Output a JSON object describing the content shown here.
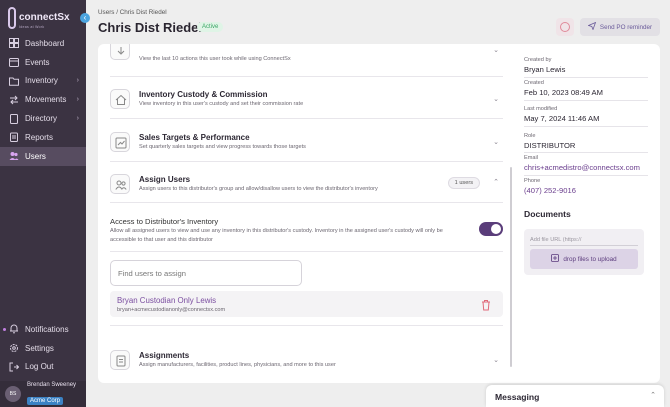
{
  "app": {
    "logo_text": "connectSx",
    "logo_subtext": "Ideas at Work",
    "collapse_icon": "chevron-left-icon"
  },
  "sidebar": {
    "items": [
      {
        "label": "Dashboard",
        "icon": "dashboard-icon",
        "has_submenu": false,
        "active": false
      },
      {
        "label": "Events",
        "icon": "calendar-icon",
        "has_submenu": false,
        "active": false
      },
      {
        "label": "Inventory",
        "icon": "folder-icon",
        "has_submenu": true,
        "active": false
      },
      {
        "label": "Movements",
        "icon": "arrows-icon",
        "has_submenu": true,
        "active": false
      },
      {
        "label": "Directory",
        "icon": "book-icon",
        "has_submenu": true,
        "active": false
      },
      {
        "label": "Reports",
        "icon": "clipboard-icon",
        "has_submenu": false,
        "active": false
      },
      {
        "label": "Users",
        "icon": "users-icon",
        "has_submenu": false,
        "active": true
      }
    ],
    "bottom_items": [
      {
        "label": "Notifications",
        "icon": "bell-icon"
      },
      {
        "label": "Settings",
        "icon": "gear-icon"
      },
      {
        "label": "Log Out",
        "icon": "logout-icon"
      }
    ],
    "user": {
      "initials": "BS",
      "name": "Brendan Sweeney",
      "org": "Acme Corp"
    }
  },
  "header": {
    "breadcrumb": [
      "Users",
      "/",
      "Chris Dist Riedel"
    ],
    "title": "Chris Dist Riedel",
    "status": "Active",
    "send_button_label": "Send PO reminder"
  },
  "sections": [
    {
      "title": "",
      "description": "View the last 10 actions this user took while using ConnectSx",
      "icon": "activity-icon"
    },
    {
      "title": "Inventory Custody & Commission",
      "description": "View inventory in this user's custody and set their commission rate",
      "icon": "house-icon"
    },
    {
      "title": "Sales Targets & Performance",
      "description": "Set quarterly sales targets and view progress towards those targets",
      "icon": "chart-icon"
    },
    {
      "title": "Assign Users",
      "description": "Assign users to this distributor's group and allow/disallow users to view the distributor's inventory",
      "icon": "users-group-icon",
      "count": "1 users",
      "expanded": true
    },
    {
      "title": "Assignments",
      "description": "Assign manufacturers, facilities, product lines, physicians, and more to this user",
      "icon": "clipboard-list-icon"
    }
  ],
  "access": {
    "title": "Access to Distributor's Inventory",
    "description": "Allow all assigned users to view and use any inventory in this distributor's custody. Inventory in the assigned user's custody will only be accessible to that user and this distributor",
    "enabled": true
  },
  "assign_search": {
    "placeholder": "Find users to assign"
  },
  "assigned_users": [
    {
      "name": "Bryan Custodian Only Lewis",
      "email": "bryan+acmecustodianonly@connectsx.com"
    }
  ],
  "meta": {
    "created_by_label": "Created by",
    "created_by": "Bryan Lewis",
    "created_label": "Created",
    "created": "Feb 10, 2023 08:49 AM",
    "modified_label": "Last modified",
    "modified": "May 7, 2024 11:46 AM",
    "role_label": "Role",
    "role": "DISTRIBUTOR",
    "email_label": "Email",
    "email": "chris+acmedistro@connectsx.com",
    "phone_label": "Phone",
    "phone": "(407) 252-9016"
  },
  "documents": {
    "title": "Documents",
    "url_placeholder": "Add file URL (https://",
    "drop_label": "drop files to upload"
  },
  "messaging": {
    "title": "Messaging"
  },
  "colors": {
    "sidebar_bg": "#3b3342",
    "accent": "#6b3f8e",
    "status_green": "#3aa565",
    "badge_blue": "#3b82c4"
  }
}
